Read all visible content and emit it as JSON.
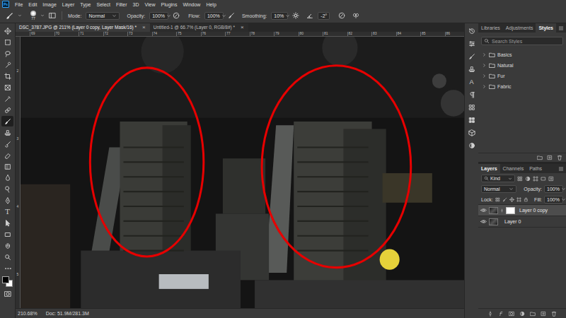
{
  "app": {
    "logo": "Ps"
  },
  "menu": [
    "File",
    "Edit",
    "Image",
    "Layer",
    "Type",
    "Select",
    "Filter",
    "3D",
    "View",
    "Plugins",
    "Window",
    "Help"
  ],
  "options": {
    "brush_size": "77",
    "mode_label": "Mode:",
    "mode": "Normal",
    "opacity_label": "Opacity:",
    "opacity": "100%",
    "flow_label": "Flow:",
    "flow": "100%",
    "smoothing_label": "Smoothing:",
    "smoothing": "10%",
    "angle": "-2°"
  },
  "tabs": [
    {
      "label": "DSC_3787.JPG @ 211% (Layer 0 copy, Layer Mask/16) *",
      "close": "×",
      "selected": true
    },
    {
      "label": "Untitled-1 @ 66.7% (Layer 0, RGB/8#) *",
      "close": "×",
      "selected": false
    }
  ],
  "toolbar": {
    "tools": [
      {
        "kind": "move",
        "selected": false
      },
      {
        "kind": "marquee",
        "selected": false
      },
      {
        "kind": "lasso",
        "selected": false
      },
      {
        "kind": "quick",
        "selected": false
      },
      {
        "kind": "crop",
        "selected": false
      },
      {
        "kind": "frame",
        "selected": false
      },
      {
        "kind": "eyedropper",
        "selected": false
      },
      {
        "kind": "heal",
        "selected": false
      },
      {
        "kind": "brush",
        "selected": true
      },
      {
        "kind": "stamp",
        "selected": false
      },
      {
        "kind": "history",
        "selected": false
      },
      {
        "kind": "eraser",
        "selected": false
      },
      {
        "kind": "gradient",
        "selected": false
      },
      {
        "kind": "blur",
        "selected": false
      },
      {
        "kind": "dodge",
        "selected": false
      },
      {
        "kind": "pen",
        "selected": false
      },
      {
        "kind": "type",
        "selected": false,
        "glyph": "T"
      },
      {
        "kind": "path",
        "selected": false
      },
      {
        "kind": "rect",
        "selected": false
      },
      {
        "kind": "hand",
        "selected": false
      },
      {
        "kind": "zoom",
        "selected": false
      },
      {
        "kind": "more",
        "selected": false
      }
    ]
  },
  "side_strip": {
    "character_glyph": "A"
  },
  "ruler": {
    "top": [
      "69",
      "70",
      "71",
      "72",
      "73",
      "74",
      "75",
      "76",
      "77",
      "78",
      "79",
      "80",
      "81",
      "82",
      "83",
      "84",
      "85",
      "86"
    ],
    "left": [
      "2",
      "3",
      "4",
      "5"
    ]
  },
  "status_bar": {
    "zoom": "210.68%",
    "doc": "Doc: 51.9M/281.3M"
  },
  "styles_panel": {
    "tabs": [
      {
        "label": "Libraries",
        "selected": false
      },
      {
        "label": "Adjustments",
        "selected": false
      },
      {
        "label": "Styles",
        "selected": true
      }
    ],
    "search": {
      "placeholder": "Search Styles"
    },
    "folders": [
      {
        "label": "Basics",
        "expanded": false
      },
      {
        "label": "Natural",
        "expanded": false
      },
      {
        "label": "Fur",
        "expanded": false
      },
      {
        "label": "Fabric",
        "expanded": false
      }
    ]
  },
  "layers_panel": {
    "tabs": [
      {
        "label": "Layers",
        "selected": true
      },
      {
        "label": "Channels",
        "selected": false
      },
      {
        "label": "Paths",
        "selected": false
      }
    ],
    "filter": "Kind",
    "blend": "Normal",
    "opacity_label": "Opacity:",
    "opacity": "100%",
    "lock_label": "Lock:",
    "fill_label": "Fill:",
    "fill": "100%",
    "layers": [
      {
        "name": "Layer 0 copy",
        "visible": true,
        "selected": true,
        "has_mask": true
      },
      {
        "name": "Layer 0",
        "visible": true,
        "selected": false,
        "has_mask": false
      }
    ]
  }
}
